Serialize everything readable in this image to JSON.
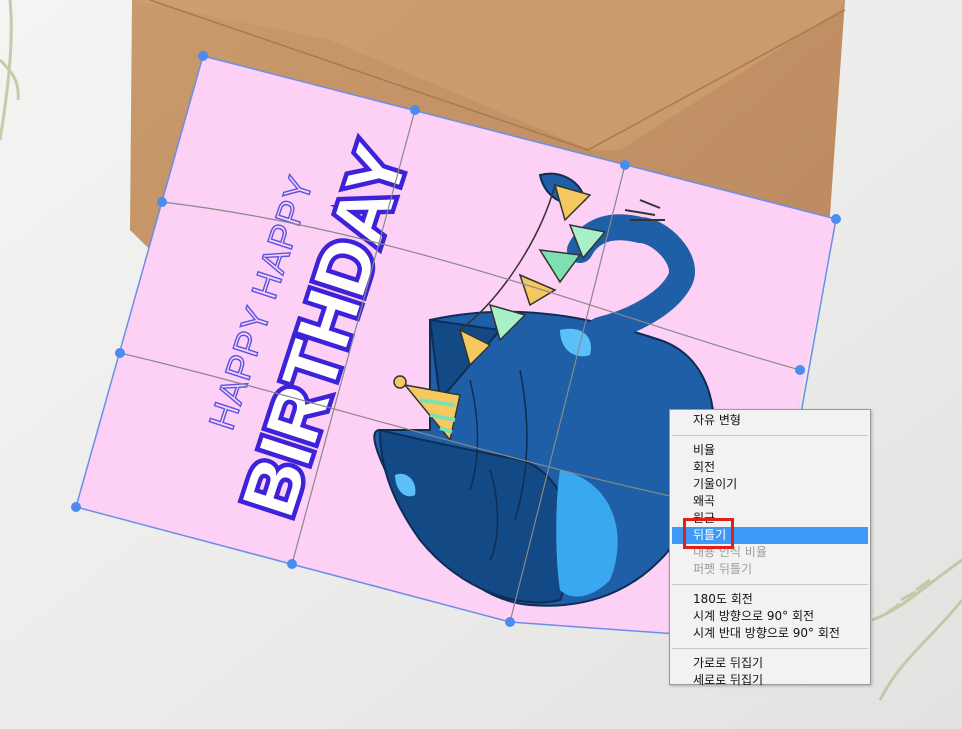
{
  "canvas": {
    "card": {
      "title_big": "BIRTHDAY",
      "title_small": "HAPPY HAPPY"
    }
  },
  "context_menu": {
    "groups": [
      [
        {
          "label": "자유 변형",
          "disabled": false
        }
      ],
      [
        {
          "label": "비율",
          "disabled": false
        },
        {
          "label": "회전",
          "disabled": false
        },
        {
          "label": "기울이기",
          "disabled": false
        },
        {
          "label": "왜곡",
          "disabled": false
        },
        {
          "label": "원근",
          "disabled": false
        },
        {
          "label": "뒤틀기",
          "disabled": false,
          "active": true
        },
        {
          "label": "내용 인식 비율",
          "disabled": true
        },
        {
          "label": "퍼펫 뒤틀기",
          "disabled": true
        }
      ],
      [
        {
          "label": "180도 회전",
          "disabled": false
        },
        {
          "label": "시계 방향으로 90° 회전",
          "disabled": false
        },
        {
          "label": "시계 반대 방향으로 90° 회전",
          "disabled": false
        }
      ],
      [
        {
          "label": "가로로 뒤집기",
          "disabled": false
        },
        {
          "label": "세로로 뒤집기",
          "disabled": false
        }
      ]
    ]
  },
  "colors": {
    "card_pink": "#fdd0f6",
    "envelope": "#c69464",
    "menu_highlight": "#3d99f5",
    "annotation_red": "#e0201a",
    "warp_handle": "#4a8cf0"
  }
}
